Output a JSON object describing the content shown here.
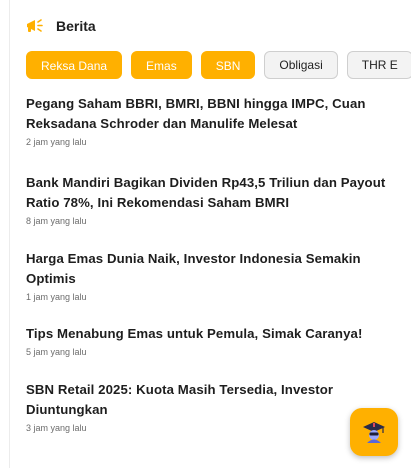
{
  "header": {
    "title": "Berita",
    "icon": "megaphone-icon"
  },
  "colors": {
    "accent": "#ffb000",
    "chip_inactive_bg": "#f3f3f3"
  },
  "chips": [
    {
      "label": "Reksa Dana",
      "active": true
    },
    {
      "label": "Emas",
      "active": true
    },
    {
      "label": "SBN",
      "active": true
    },
    {
      "label": "Obligasi",
      "active": false
    },
    {
      "label": "THR E",
      "active": false
    }
  ],
  "news": [
    {
      "title": "Pegang Saham BBRI, BMRI, BBNI hingga IMPC, Cuan Reksadana Schroder dan Manulife Melesat",
      "time": "2 jam yang lalu"
    },
    {
      "title": "Bank Mandiri Bagikan Dividen Rp43,5 Triliun dan Payout Ratio 78%, Ini Rekomendasi Saham BMRI",
      "time": "8 jam yang lalu"
    },
    {
      "title": "Harga Emas Dunia Naik, Investor Indonesia Semakin Optimis",
      "time": "1 jam yang lalu"
    },
    {
      "title": "Tips Menabung Emas untuk Pemula, Simak Caranya!",
      "time": "5 jam yang lalu"
    },
    {
      "title": "SBN Retail 2025: Kuota Masih Tersedia, Investor Diuntungkan",
      "time": "3 jam yang lalu"
    }
  ],
  "fab": {
    "icon": "graduation-cap-icon"
  }
}
